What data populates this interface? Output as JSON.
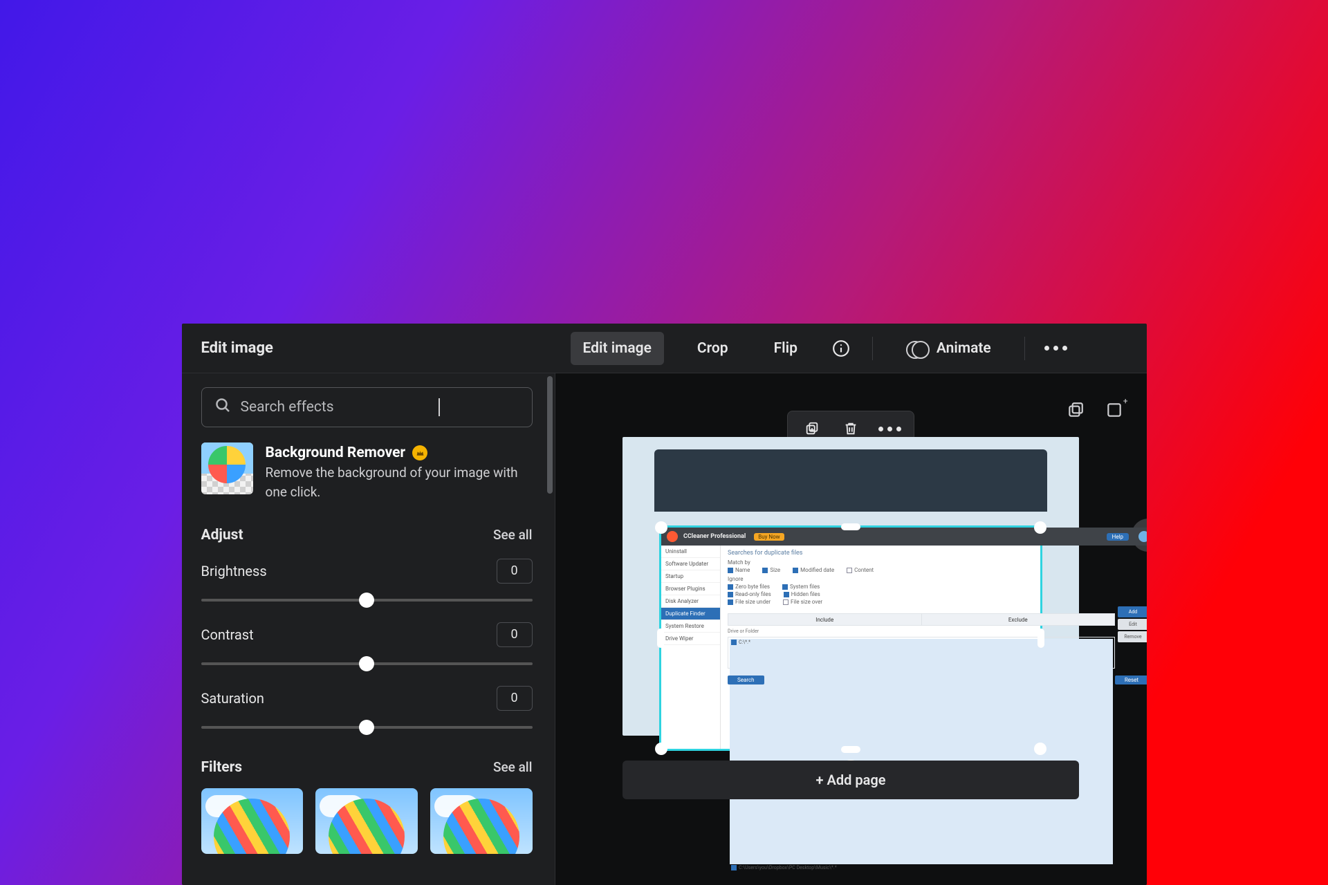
{
  "sidebar_title": "Edit image",
  "top": {
    "edit_image": "Edit image",
    "crop": "Crop",
    "flip": "Flip",
    "animate": "Animate"
  },
  "search": {
    "placeholder": "Search effects"
  },
  "bg_remover": {
    "title": "Background Remover",
    "desc": "Remove the background of your image with one click."
  },
  "adjust": {
    "heading": "Adjust",
    "see_all": "See all",
    "items": [
      {
        "label": "Brightness",
        "value": "0"
      },
      {
        "label": "Contrast",
        "value": "0"
      },
      {
        "label": "Saturation",
        "value": "0"
      }
    ]
  },
  "filters": {
    "heading": "Filters",
    "see_all": "See all"
  },
  "add_page": "+ Add page",
  "inner": {
    "title": "CCleaner Professional",
    "buy": "Buy Now",
    "help": "Help",
    "side": [
      "Uninstall",
      "Software Updater",
      "Startup",
      "Browser Plugins",
      "Disk Analyzer",
      "Duplicate Finder",
      "System Restore",
      "Drive Wiper"
    ],
    "side_active_index": 5,
    "heading": "Searches for duplicate files",
    "match_label": "Match by",
    "match_opts": [
      "Name",
      "Size",
      "Modified date",
      "Content"
    ],
    "ignore_label": "Ignore",
    "ignore_opts": [
      "Zero byte files",
      "System files",
      "Read-only files",
      "Hidden files",
      "File size under",
      "File size over"
    ],
    "tabs": [
      "Include",
      "Exclude"
    ],
    "btns": [
      "Add",
      "Edit",
      "Remove"
    ],
    "list_label": "Drive or Folder",
    "list_items": [
      "C:\\*.*",
      "C:\\Users\\you\\Dropbox\\PC Desktop\\Music\\*.*"
    ],
    "search_btn": "Search",
    "reset_btn": "Reset"
  }
}
